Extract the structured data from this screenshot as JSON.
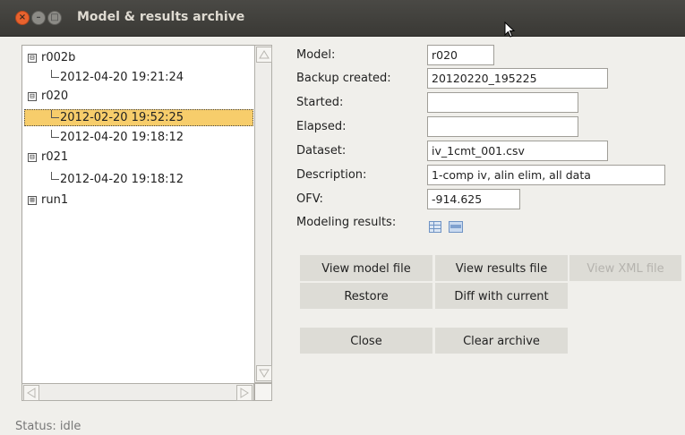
{
  "window": {
    "title": "Model & results archive"
  },
  "tree": {
    "nodes": [
      {
        "label": "r002b",
        "expander": "⊟",
        "children": [
          "2012-04-20 19:21:24"
        ]
      },
      {
        "label": "r020",
        "expander": "⊟",
        "children": [
          "2012-02-20 19:52:25",
          "2012-04-20 19:18:12"
        ]
      },
      {
        "label": "r021",
        "expander": "⊟",
        "children": [
          "2012-04-20 19:18:12"
        ]
      },
      {
        "label": "run1",
        "expander": "⊞",
        "children": []
      }
    ],
    "selected": "2012-02-20 19:52:25"
  },
  "form": {
    "model_label": "Model:",
    "model_value": "r020",
    "backup_label": "Backup created:",
    "backup_value": "20120220_195225",
    "started_label": "Started:",
    "started_value": "",
    "elapsed_label": "Elapsed:",
    "elapsed_value": "",
    "dataset_label": "Dataset:",
    "dataset_value": "iv_1cmt_001.csv",
    "description_label": "Description:",
    "description_value": "1-comp iv, alin elim, all data",
    "ofv_label": "OFV:",
    "ofv_value": "-914.625",
    "results_label": "Modeling results:",
    "results_icons": [
      "table-icon",
      "document-icon"
    ]
  },
  "buttons": {
    "view_model": "View model file",
    "view_results": "View results file",
    "view_xml": "View XML file",
    "restore": "Restore",
    "diff": "Diff with current",
    "close": "Close",
    "clear": "Clear archive"
  },
  "status": {
    "text": "Status: idle"
  },
  "colors": {
    "selection": "#f7cd6b",
    "close_button": "#e8622e",
    "titlebar": "#3f3e3a"
  }
}
